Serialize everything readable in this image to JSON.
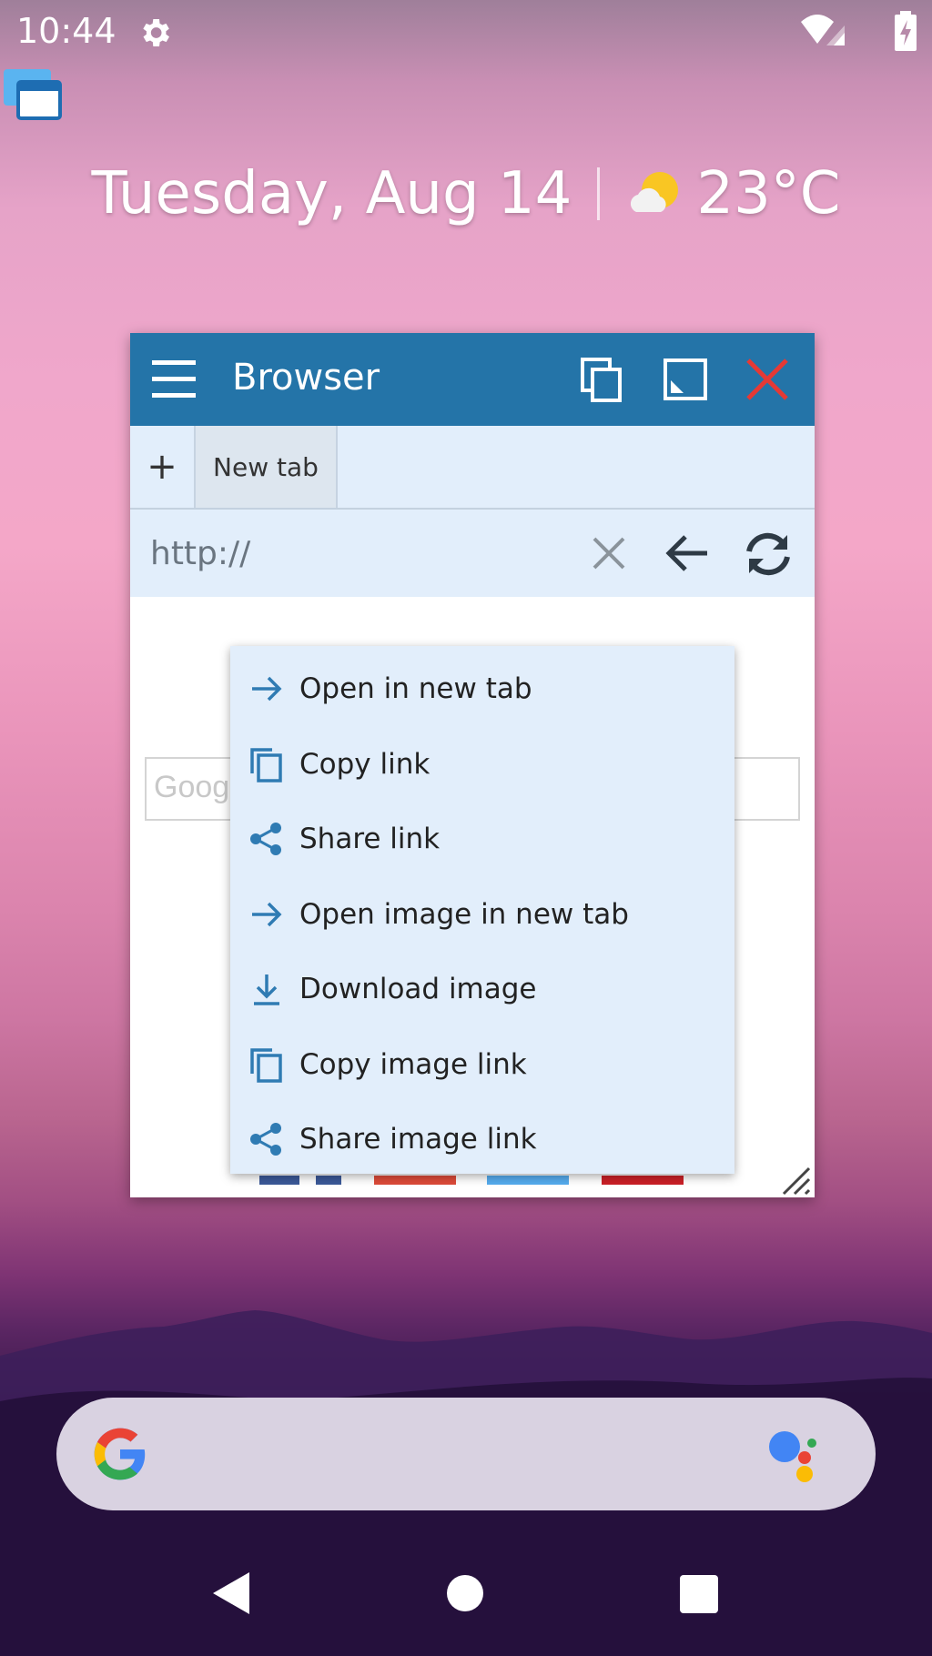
{
  "status_bar": {
    "time": "10:44",
    "settings_icon": "gear-icon",
    "wifi_icon": "wifi-icon",
    "signal_icon": "signal-icon",
    "battery_icon": "battery-charging-icon"
  },
  "date_widget": {
    "date": "Tuesday, Aug 14",
    "weather_icon": "partly-cloudy-icon",
    "temperature": "23°C"
  },
  "browser": {
    "title": "Browser",
    "tab_add": "+",
    "tabs": [
      {
        "label": "New tab"
      }
    ],
    "url": {
      "value": "",
      "placeholder": "http://"
    },
    "search_partial": "Goog",
    "colors": {
      "titlebar": "#2474a8",
      "close": "#e53935",
      "panel": "#e2eefb",
      "accent": "#2f7bb3"
    }
  },
  "context_menu": {
    "items": [
      {
        "label": "Open in new tab",
        "icon": "arrow-right-icon"
      },
      {
        "label": "Copy link",
        "icon": "copy-icon"
      },
      {
        "label": "Share link",
        "icon": "share-icon"
      },
      {
        "label": "Open image in new tab",
        "icon": "arrow-right-icon"
      },
      {
        "label": "Download image",
        "icon": "download-icon"
      },
      {
        "label": "Copy image link",
        "icon": "copy-icon"
      },
      {
        "label": "Share image link",
        "icon": "share-icon"
      }
    ]
  },
  "search_bar": {
    "logo": "google-logo",
    "assistant": "assistant-icon"
  },
  "nav_bar": {
    "back": "back-icon",
    "home": "home-icon",
    "recents": "recents-icon"
  }
}
